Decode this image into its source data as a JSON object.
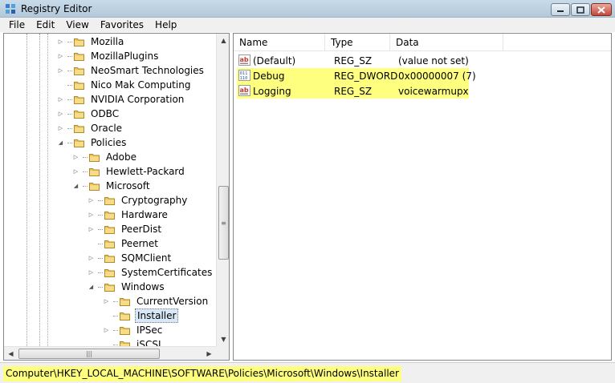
{
  "window": {
    "title": "Registry Editor"
  },
  "menu": [
    "File",
    "Edit",
    "View",
    "Favorites",
    "Help"
  ],
  "tree": {
    "items": [
      {
        "label": "Mozilla",
        "level": 0,
        "expander": "collapsed"
      },
      {
        "label": "MozillaPlugins",
        "level": 0,
        "expander": "collapsed"
      },
      {
        "label": "NeoSmart Technologies",
        "level": 0,
        "expander": "collapsed"
      },
      {
        "label": "Nico Mak Computing",
        "level": 0,
        "expander": "none"
      },
      {
        "label": "NVIDIA Corporation",
        "level": 0,
        "expander": "collapsed"
      },
      {
        "label": "ODBC",
        "level": 0,
        "expander": "collapsed"
      },
      {
        "label": "Oracle",
        "level": 0,
        "expander": "collapsed"
      },
      {
        "label": "Policies",
        "level": 0,
        "expander": "expanded"
      },
      {
        "label": "Adobe",
        "level": 1,
        "expander": "collapsed"
      },
      {
        "label": "Hewlett-Packard",
        "level": 1,
        "expander": "collapsed"
      },
      {
        "label": "Microsoft",
        "level": 1,
        "expander": "expanded"
      },
      {
        "label": "Cryptography",
        "level": 2,
        "expander": "collapsed"
      },
      {
        "label": "Hardware",
        "level": 2,
        "expander": "collapsed"
      },
      {
        "label": "PeerDist",
        "level": 2,
        "expander": "collapsed"
      },
      {
        "label": "Peernet",
        "level": 2,
        "expander": "none"
      },
      {
        "label": "SQMClient",
        "level": 2,
        "expander": "collapsed"
      },
      {
        "label": "SystemCertificates",
        "level": 2,
        "expander": "collapsed"
      },
      {
        "label": "Windows",
        "level": 2,
        "expander": "expanded"
      },
      {
        "label": "CurrentVersion",
        "level": 3,
        "expander": "collapsed"
      },
      {
        "label": "Installer",
        "level": 3,
        "expander": "none",
        "selected": true
      },
      {
        "label": "IPSec",
        "level": 3,
        "expander": "collapsed"
      },
      {
        "label": "iSCSI",
        "level": 3,
        "expander": "none"
      }
    ]
  },
  "values": {
    "columns": [
      "Name",
      "Type",
      "Data"
    ],
    "rows": [
      {
        "name": "(Default)",
        "type": "REG_SZ",
        "data": "(value not set)",
        "icon": "string-value-icon",
        "highlight": false
      },
      {
        "name": "Debug",
        "type": "REG_DWORD",
        "data": "0x00000007 (7)",
        "icon": "binary-value-icon",
        "highlight": true
      },
      {
        "name": "Logging",
        "type": "REG_SZ",
        "data": "voicewarmupx",
        "icon": "string-value-icon",
        "highlight": true
      }
    ]
  },
  "status": {
    "path": "Computer\\HKEY_LOCAL_MACHINE\\SOFTWARE\\Policies\\Microsoft\\Windows\\Installer"
  },
  "colors": {
    "highlight": "#ffff7f",
    "folder": "#e8c55a",
    "selection": "#d9e8f8"
  }
}
